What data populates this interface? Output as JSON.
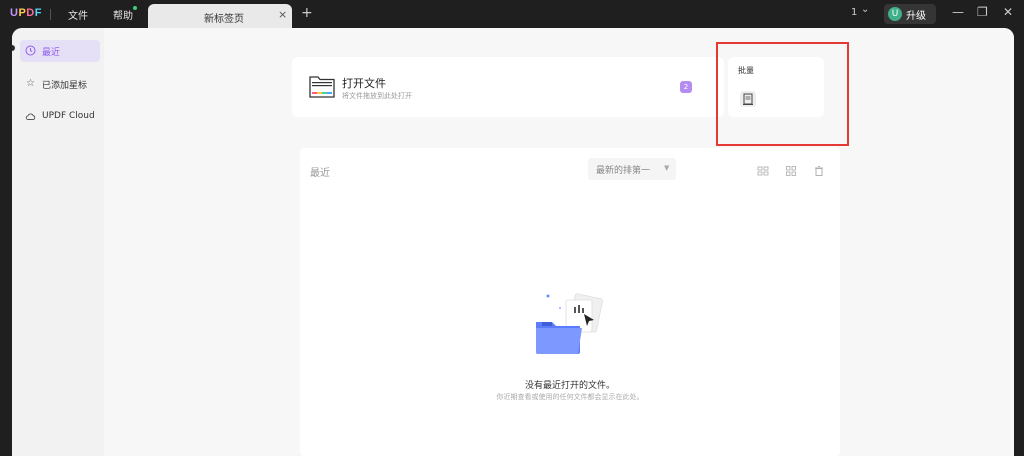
{
  "app": {
    "logo": {
      "u": "U",
      "p": "P",
      "d": "D",
      "f": "F"
    },
    "menu": {
      "file": "文件",
      "help": "帮助"
    },
    "tab": {
      "title": "新标签页",
      "close": "×",
      "new": "+"
    },
    "page_indicator": "1",
    "upgrade": {
      "avatar": "U",
      "label": "升级"
    },
    "window_controls": {
      "minimize": "—",
      "restore": "❐",
      "close": "✕"
    }
  },
  "sidebar": {
    "items": [
      {
        "icon": "clock-icon",
        "label": "最近",
        "active": true
      },
      {
        "icon": "star-icon",
        "label": "已添加星标",
        "active": false
      },
      {
        "icon": "cloud-icon",
        "label": "UPDF Cloud",
        "active": false
      }
    ]
  },
  "open_file": {
    "title": "打开文件",
    "subtitle": "将文件拖放到此处打开",
    "badge": "2"
  },
  "batch": {
    "label": "批量",
    "icon": "batch-document-icon"
  },
  "recent": {
    "title": "最近",
    "sort_label": "最新的排第一",
    "empty_title": "没有最近打开的文件。",
    "empty_subtitle": "你近期查看或使用的任何文件都会显示在此处。"
  },
  "colors": {
    "accent": "#8f5cf0",
    "highlight": "#e53935",
    "avatar": "#3fb089"
  }
}
